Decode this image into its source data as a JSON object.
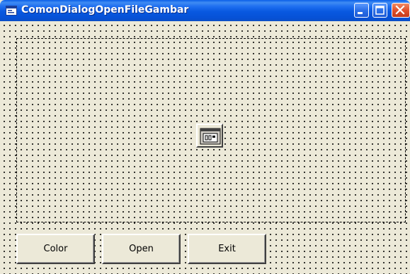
{
  "window": {
    "title": "ComonDialogOpenFileGambar",
    "controls": [
      "minimize-icon",
      "maximize-icon",
      "close-icon"
    ]
  },
  "form": {
    "picture_box": {
      "style": "dashed"
    },
    "common_dialog_icon": "common-dialog-control-icon"
  },
  "buttons": {
    "color_label": "Color",
    "open_label": "Open",
    "exit_label": "Exit"
  },
  "colors": {
    "title_bar": "#0858e0",
    "form_background": "#ece9d8",
    "close_button": "#e0512c"
  }
}
